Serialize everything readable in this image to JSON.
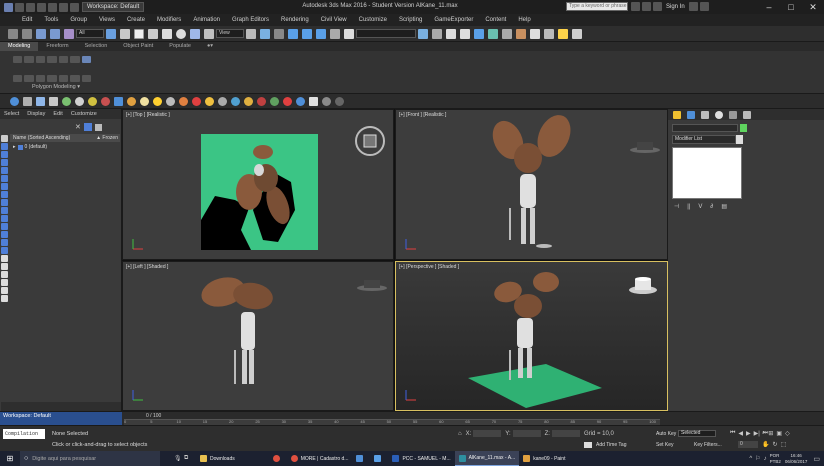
{
  "window": {
    "title": "Autodesk 3ds Max 2016 - Student Version   AlKane_11.max",
    "workspace_label": "Workspace: Default",
    "search_placeholder": "Type a keyword or phrase",
    "sign_in": "Sign In"
  },
  "menu": [
    "Edit",
    "Tools",
    "Group",
    "Views",
    "Create",
    "Modifiers",
    "Animation",
    "Graph Editors",
    "Rendering",
    "Civil View",
    "Customize",
    "Scripting",
    "GameExporter",
    "Content",
    "Help"
  ],
  "toolbar": {
    "selection_filter": "All",
    "view_dropdown": "View"
  },
  "ribbon": {
    "tabs": [
      "Modeling",
      "Freeform",
      "Selection",
      "Object Paint",
      "Populate"
    ],
    "panel_label": "Polygon Modeling ▾"
  },
  "scene_explorer": {
    "menu": [
      "Select",
      "Display",
      "Edit",
      "Customize"
    ],
    "column_name": "Name (Sorted Ascending)",
    "column_frozen": "▲ Frozen",
    "root_item": "0 (default)"
  },
  "viewports": {
    "top": "[+] [Top ] [Realistic ]",
    "front": "[+] [Front ] [Realistic ]",
    "left": "[+] [Left ] [Shaded ]",
    "perspective": "[+] [Perspective ] [Shaded ]"
  },
  "command_panel": {
    "modifier_list": "Modifier List"
  },
  "timeline": {
    "frame_counter": "0 / 100",
    "ticks": [
      "0",
      "5",
      "10",
      "15",
      "20",
      "25",
      "30",
      "35",
      "40",
      "45",
      "50",
      "55",
      "60",
      "65",
      "70",
      "75",
      "80",
      "85",
      "90",
      "95",
      "100"
    ]
  },
  "status": {
    "workspace": "Workspace: Default",
    "script_listener": "Compilation",
    "none_selected": "None Selected",
    "prompt": "Click or click-and-drag to select objects",
    "x_label": "X:",
    "y_label": "Y:",
    "z_label": "Z:",
    "grid": "Grid = 10,0",
    "add_time_tag": "Add Time Tag",
    "auto_key": "Auto Key",
    "set_key": "Set Key",
    "selected": "Selected",
    "key_filters": "Key Filters...",
    "frame": "0"
  },
  "taskbar": {
    "search_placeholder": "Digite aqui para pesquisar",
    "items": [
      "Downloads",
      "MORE | Cadastro d...",
      "PCC - SAMUEL - M...",
      "AlKane_11.max - A...",
      "kane09 - Paint"
    ],
    "lang": "POR",
    "lang2": "PTB2",
    "time": "16:46",
    "date": "06/06/2017"
  },
  "colors": {
    "viewport_bg": "#3d3d3d",
    "top_ground": "#3bc585",
    "persp_ground": "#2fb173",
    "character": "#8a5a3c",
    "accent": "#4f7fd8"
  }
}
